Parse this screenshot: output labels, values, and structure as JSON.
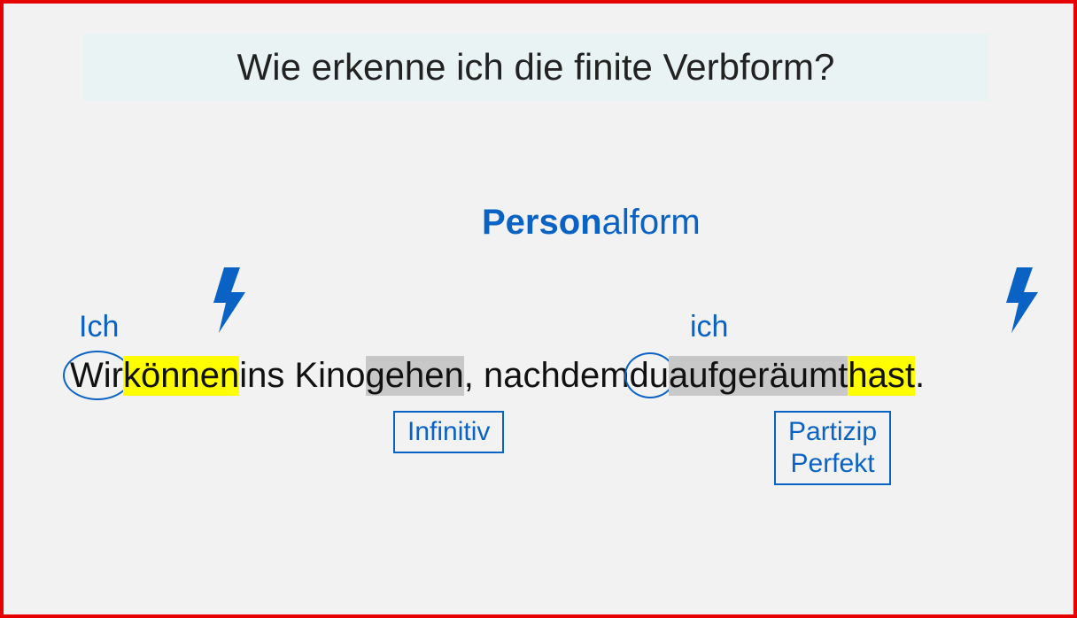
{
  "title": "Wie erkenne ich die finite Verbform?",
  "heading": {
    "bold": "Person",
    "rest": "alform"
  },
  "pronoun1": "Ich",
  "pronoun2": "ich",
  "sentence": {
    "wir": "Wir",
    "space1": " ",
    "koennen": "können",
    "mid1": " ins Kino ",
    "gehen": "gehen",
    "mid2": ", nachdem ",
    "du": "du",
    "space2": " ",
    "aufgeraeumt": "aufgeräumt",
    "space3": " ",
    "hast": "hast",
    "period": "."
  },
  "annotation1": "Infinitiv",
  "annotation2_line1": "Partizip",
  "annotation2_line2": "Perfekt"
}
